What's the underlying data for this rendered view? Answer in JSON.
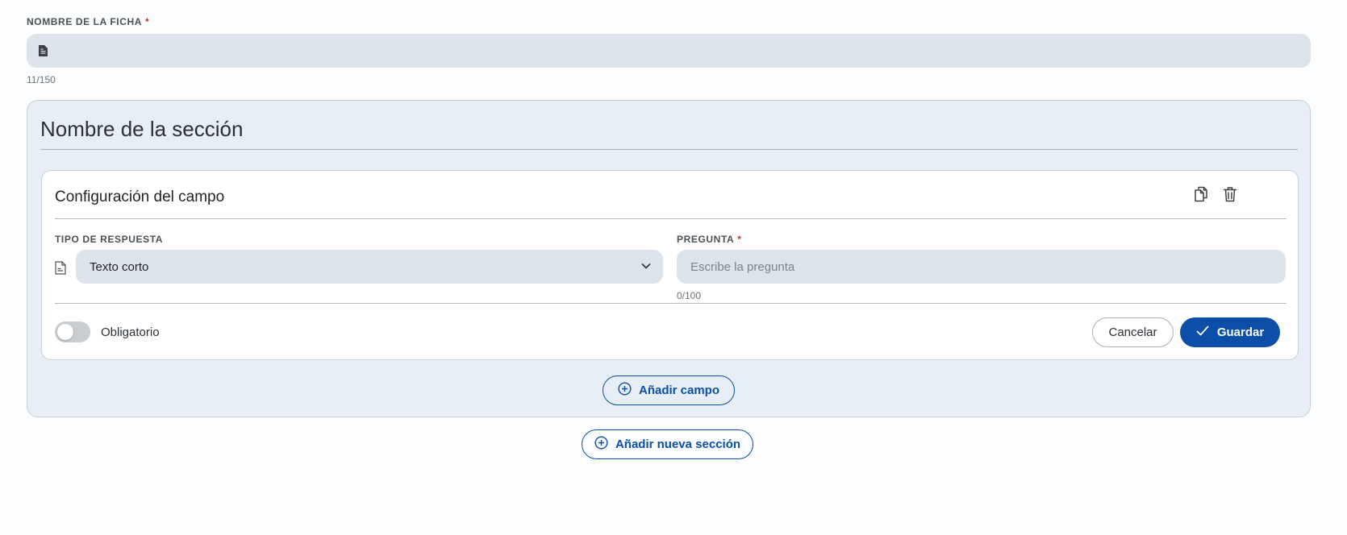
{
  "ficha": {
    "label": "NOMBRE DE LA FICHA",
    "required_mark": "*",
    "value": "",
    "counter": "11/150",
    "icon": "document-icon"
  },
  "section": {
    "title": "Nombre de la sección",
    "card": {
      "title": "Configuración del campo",
      "actions": {
        "copy_icon": "copy-icon",
        "delete_icon": "trash-icon"
      },
      "tipo": {
        "label": "TIPO DE RESPUESTA",
        "value": "Texto corto",
        "icon": "text-document-icon"
      },
      "pregunta": {
        "label": "PREGUNTA",
        "required_mark": "*",
        "placeholder": "Escribe la pregunta",
        "value": "",
        "counter": "0/100"
      },
      "required_toggle": {
        "label": "Obligatorio",
        "on": false
      },
      "cancel_label": "Cancelar",
      "save_label": "Guardar"
    },
    "add_field_label": "Añadir campo"
  },
  "add_section_label": "Añadir nueva sección",
  "colors": {
    "primary": "#0b4fa8",
    "input_bg": "#dde3ea",
    "section_bg": "#e8eef5",
    "required": "#c0392b"
  }
}
